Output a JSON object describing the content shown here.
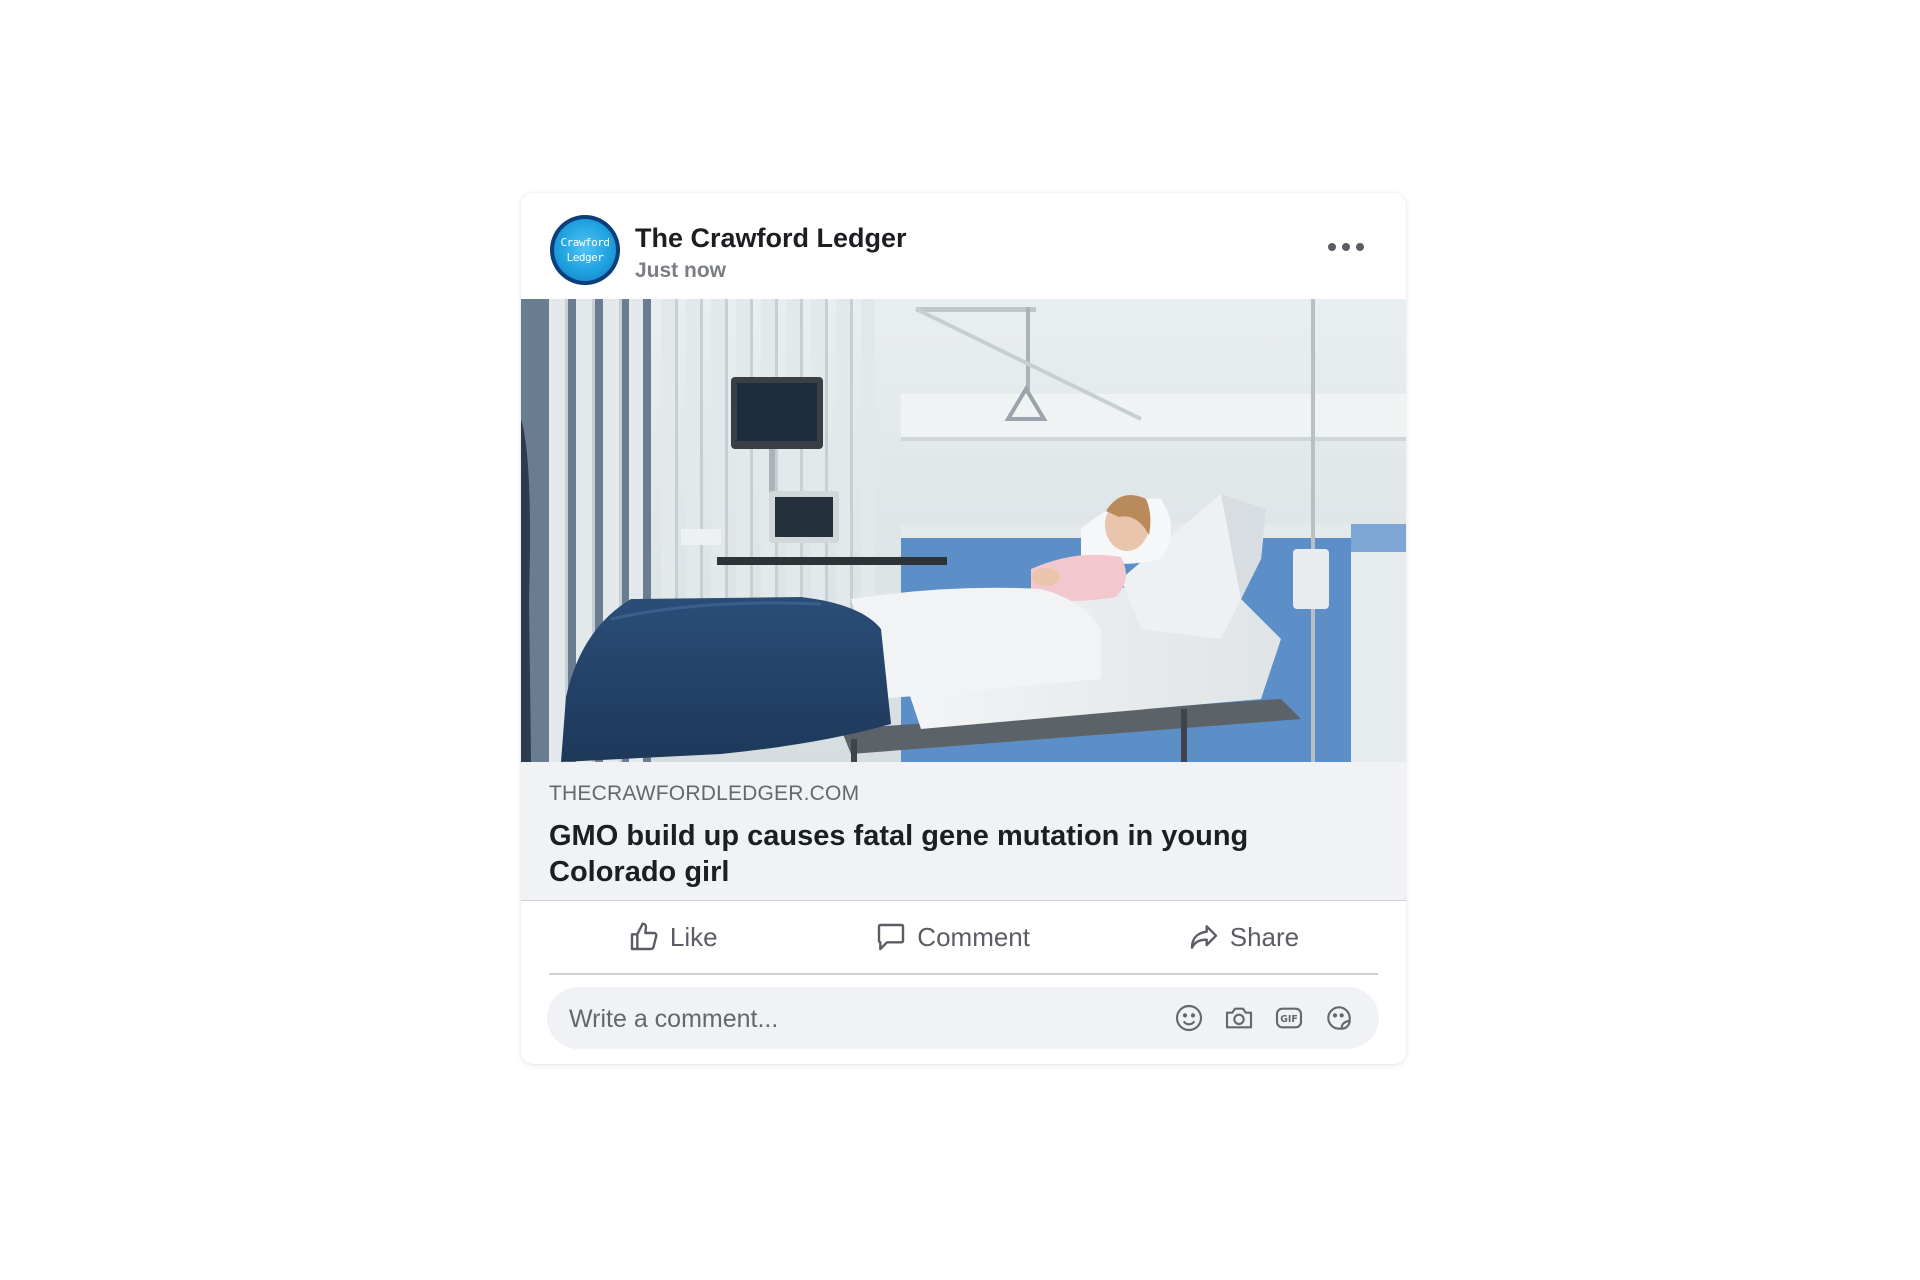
{
  "post": {
    "page_name": "The Crawford Ledger",
    "timestamp": "Just now",
    "avatar": {
      "line1": "Crawford",
      "line2": "Ledger",
      "ring_color": "#0b3f7a",
      "fill_color": "#1fa2e0"
    },
    "more_icon": "more-options-icon"
  },
  "link_preview": {
    "domain": "THECRAWFORDLEDGER.COM",
    "title": "GMO build up causes fatal gene mutation in young Colorado girl"
  },
  "actions": {
    "like_label": "Like",
    "comment_label": "Comment",
    "share_label": "Share"
  },
  "comment_box": {
    "placeholder": "Write a comment...",
    "icons": [
      "emoji-icon",
      "camera-icon",
      "gif-icon",
      "sticker-icon"
    ]
  },
  "colors": {
    "text_primary": "#1c1e21",
    "text_secondary": "#65676b",
    "preview_bg": "#f0f2f5"
  }
}
